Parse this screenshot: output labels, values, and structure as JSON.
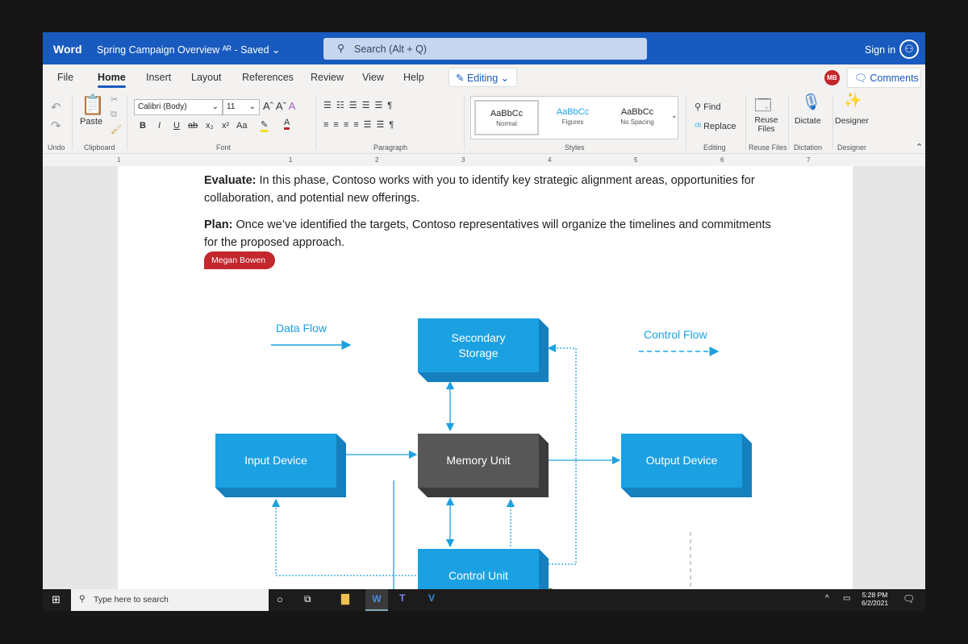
{
  "title_bar": {
    "app": "Word",
    "document": "Spring Campaign Overview",
    "status": "- Saved",
    "search_placeholder": "Search (Alt + Q)",
    "sign_in": "Sign in"
  },
  "tabs": [
    "File",
    "Home",
    "Insert",
    "Layout",
    "References",
    "Review",
    "View",
    "Help"
  ],
  "editing_mode": "Editing",
  "user_initials": "MB",
  "comments_label": "Comments",
  "ribbon": {
    "groups": [
      "Undo",
      "Clipboard",
      "Font",
      "Paragraph",
      "Styles",
      "Editing",
      "Reuse Files",
      "Dictation",
      "Designer"
    ],
    "paste": "Paste",
    "font_name": "Calibri (Body)",
    "font_size": "11",
    "font_buttons": [
      "B",
      "I",
      "U",
      "ab",
      "x₂",
      "x²",
      "Aa"
    ],
    "styles": [
      {
        "sample": "AaBbCc",
        "name": "Normal"
      },
      {
        "sample": "AaBbCc",
        "name": "Figures"
      },
      {
        "sample": "AaBbCc",
        "name": "No Spacing"
      }
    ],
    "find": "Find",
    "replace": "Replace",
    "reuse_files": "Reuse Files",
    "dictate": "Dictate",
    "designer": "Designer"
  },
  "ruler": [
    "1",
    "1",
    "2",
    "3",
    "4",
    "5",
    "6",
    "7"
  ],
  "document": {
    "p1_bold": "Evaluate:",
    "p1": " In this phase, Contoso works with you to identify key strategic alignment areas, opportunities for collaboration, and potential new offerings.",
    "p2_bold": "Plan:",
    "p2": " Once we’ve identified the targets, Contoso representatives will organize the timelines and commitments for the proposed approach.",
    "comment_author": "Megan Bowen"
  },
  "diagram": {
    "legend_data": "Data Flow",
    "legend_control": "Control Flow",
    "secondary": [
      "Secondary",
      "Storage"
    ],
    "input": "Input Device",
    "memory": "Memory Unit",
    "output": "Output Device",
    "control": "Control Unit",
    "colors": {
      "box": "#1ba1e2",
      "box_side": "#1580bd",
      "memory": "#575757",
      "arrow": "#1ba1e2"
    }
  },
  "taskbar": {
    "search_placeholder": "Type here to search",
    "time": "5:28 PM",
    "date": "6/2/2021"
  }
}
